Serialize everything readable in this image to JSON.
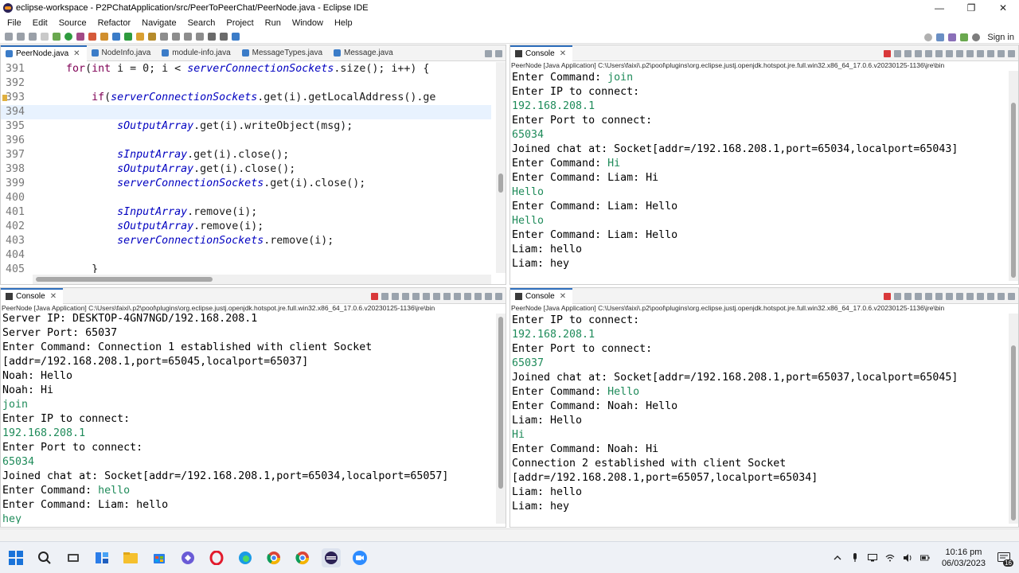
{
  "window": {
    "title": "eclipse-workspace - P2PChatApplication/src/PeerToPeerChat/PeerNode.java - Eclipse IDE",
    "minimize": "—",
    "maximize": "❐",
    "close": "✕"
  },
  "menu": [
    "File",
    "Edit",
    "Source",
    "Refactor",
    "Navigate",
    "Search",
    "Project",
    "Run",
    "Window",
    "Help"
  ],
  "toolbar": {
    "sign_in": "Sign in"
  },
  "editor": {
    "tabs": [
      {
        "label": "PeerNode.java",
        "active": true
      },
      {
        "label": "NodeInfo.java",
        "active": false
      },
      {
        "label": "module-info.java",
        "active": false
      },
      {
        "label": "MessageTypes.java",
        "active": false
      },
      {
        "label": "Message.java",
        "active": false
      }
    ],
    "lines": [
      {
        "no": "391",
        "indent": "      ",
        "parts": [
          [
            "kw",
            "for"
          ],
          [
            "code",
            "("
          ],
          [
            "kw",
            "int"
          ],
          [
            "code",
            " i = 0; i < "
          ],
          [
            "field",
            "serverConnectionSockets"
          ],
          [
            "code",
            ".size(); i++) {"
          ]
        ]
      },
      {
        "no": "392",
        "indent": "",
        "parts": []
      },
      {
        "no": "393",
        "indent": "          ",
        "mark": true,
        "parts": [
          [
            "kw",
            "if"
          ],
          [
            "code",
            "("
          ],
          [
            "field",
            "serverConnectionSockets"
          ],
          [
            "code",
            ".get(i).getLocalAddress().ge"
          ]
        ]
      },
      {
        "no": "394",
        "indent": "",
        "hl": true,
        "parts": []
      },
      {
        "no": "395",
        "indent": "              ",
        "parts": [
          [
            "field",
            "sOutputArray"
          ],
          [
            "code",
            ".get(i).writeObject(msg);"
          ]
        ]
      },
      {
        "no": "396",
        "indent": "",
        "parts": []
      },
      {
        "no": "397",
        "indent": "              ",
        "parts": [
          [
            "field",
            "sInputArray"
          ],
          [
            "code",
            ".get(i).close();"
          ]
        ]
      },
      {
        "no": "398",
        "indent": "              ",
        "parts": [
          [
            "field",
            "sOutputArray"
          ],
          [
            "code",
            ".get(i).close();"
          ]
        ]
      },
      {
        "no": "399",
        "indent": "              ",
        "parts": [
          [
            "field",
            "serverConnectionSockets"
          ],
          [
            "code",
            ".get(i).close();"
          ]
        ]
      },
      {
        "no": "400",
        "indent": "",
        "parts": []
      },
      {
        "no": "401",
        "indent": "              ",
        "parts": [
          [
            "field",
            "sInputArray"
          ],
          [
            "code",
            ".remove(i);"
          ]
        ]
      },
      {
        "no": "402",
        "indent": "              ",
        "parts": [
          [
            "field",
            "sOutputArray"
          ],
          [
            "code",
            ".remove(i);"
          ]
        ]
      },
      {
        "no": "403",
        "indent": "              ",
        "parts": [
          [
            "field",
            "serverConnectionSockets"
          ],
          [
            "code",
            ".remove(i);"
          ]
        ]
      },
      {
        "no": "404",
        "indent": "",
        "parts": []
      },
      {
        "no": "405",
        "indent": "          ",
        "parts": [
          [
            "code",
            "}"
          ]
        ]
      }
    ]
  },
  "consoles": {
    "top_right": {
      "tab": "Console",
      "desc": "PeerNode [Java Application] C:\\Users\\faixi\\.p2\\pool\\plugins\\org.eclipse.justj.openjdk.hotspot.jre.full.win32.x86_64_17.0.6.v20230125-1136\\jre\\bin",
      "lines": [
        {
          "t": "Enter Command: ",
          "in": "join"
        },
        {
          "t": "Enter IP to connect:"
        },
        {
          "in": "192.168.208.1"
        },
        {
          "t": "Enter Port to connect:"
        },
        {
          "in": "65034"
        },
        {
          "t": "Joined chat at: Socket[addr=/192.168.208.1,port=65034,localport=65043]"
        },
        {
          "t": "Enter Command: ",
          "in": "Hi"
        },
        {
          "t": "Enter Command: Liam: Hi"
        },
        {
          "in": "Hello"
        },
        {
          "t": "Enter Command: Liam: Hello"
        },
        {
          "in": "Hello"
        },
        {
          "t": "Enter Command: Liam: Hello"
        },
        {
          "t": "Liam: hello"
        },
        {
          "t": "Liam: hey"
        }
      ]
    },
    "bottom_left": {
      "tab": "Console",
      "desc": "PeerNode [Java Application] C:\\Users\\faixi\\.p2\\pool\\plugins\\org.eclipse.justj.openjdk.hotspot.jre.full.win32.x86_64_17.0.6.v20230125-1136\\jre\\bin",
      "lines": [
        {
          "t": "Server IP: DESKTOP-4GN7NGD/192.168.208.1"
        },
        {
          "t": "Server Port: 65037"
        },
        {
          "t": "Enter Command: Connection 1 established with client Socket"
        },
        {
          "t": "[addr=/192.168.208.1,port=65045,localport=65037]"
        },
        {
          "t": "Noah: Hello"
        },
        {
          "t": "Noah: Hi"
        },
        {
          "in": "join"
        },
        {
          "t": "Enter IP to connect:"
        },
        {
          "in": "192.168.208.1"
        },
        {
          "t": "Enter Port to connect:"
        },
        {
          "in": "65034"
        },
        {
          "t": "Joined chat at: Socket[addr=/192.168.208.1,port=65034,localport=65057]"
        },
        {
          "t": "Enter Command: ",
          "in": "hello"
        },
        {
          "t": "Enter Command: Liam: hello"
        },
        {
          "in": "hey"
        }
      ]
    },
    "bottom_right": {
      "tab": "Console",
      "desc": "PeerNode [Java Application] C:\\Users\\faixi\\.p2\\pool\\plugins\\org.eclipse.justj.openjdk.hotspot.jre.full.win32.x86_64_17.0.6.v20230125-1136\\jre\\bin",
      "lines": [
        {
          "t": "Enter IP to connect:"
        },
        {
          "in": "192.168.208.1"
        },
        {
          "t": "Enter Port to connect:"
        },
        {
          "in": "65037"
        },
        {
          "t": "Joined chat at: Socket[addr=/192.168.208.1,port=65037,localport=65045]"
        },
        {
          "t": "Enter Command: ",
          "in": "Hello"
        },
        {
          "t": "Enter Command: Noah: Hello"
        },
        {
          "t": "Liam: Hello"
        },
        {
          "in": "Hi"
        },
        {
          "t": "Enter Command: Noah: Hi"
        },
        {
          "t": "Connection 2 established with client Socket"
        },
        {
          "t": "[addr=/192.168.208.1,port=65057,localport=65034]"
        },
        {
          "t": "Liam: hello"
        },
        {
          "t": "Liam: hey"
        }
      ]
    }
  },
  "taskbar": {
    "time": "10:16 pm",
    "date": "06/03/2023",
    "notification_count": "16"
  },
  "colors": {
    "keyword": "#7f0055",
    "field": "#0000c0",
    "console_input": "#1f8b5a",
    "active_tab_accent": "#2f6fbd"
  }
}
